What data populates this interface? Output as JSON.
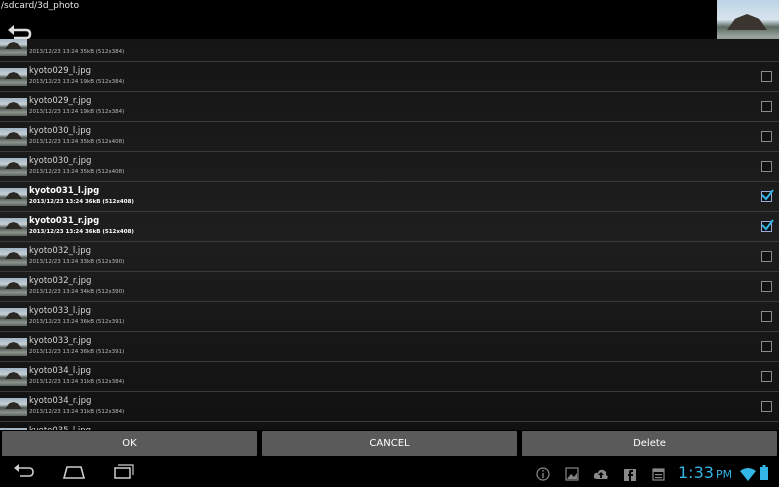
{
  "header": {
    "path": "/sdcard/3d_photo",
    "back_icon": "back-arrow-icon",
    "preview_icon": "photo-thumbnail"
  },
  "files": [
    {
      "name": "",
      "meta": "2013/12/23 13:24  35kB (512x384)",
      "checked": false,
      "partial": true
    },
    {
      "name": "kyoto029_l.jpg",
      "meta": "2013/12/23 13:24  19kB (512x384)",
      "checked": false
    },
    {
      "name": "kyoto029_r.jpg",
      "meta": "2013/12/23 13:24  19kB (512x384)",
      "checked": false
    },
    {
      "name": "kyoto030_l.jpg",
      "meta": "2013/12/23 13:24  35kB (512x408)",
      "checked": false
    },
    {
      "name": "kyoto030_r.jpg",
      "meta": "2013/12/23 13:24  35kB (512x408)",
      "checked": false
    },
    {
      "name": "kyoto031_l.jpg",
      "meta": "2013/12/23 13:24  36kB (512x408)",
      "checked": true
    },
    {
      "name": "kyoto031_r.jpg",
      "meta": "2013/12/23 13:24  36kB (512x408)",
      "checked": true
    },
    {
      "name": "kyoto032_l.jpg",
      "meta": "2013/12/23 13:24  33kB (512x390)",
      "checked": false
    },
    {
      "name": "kyoto032_r.jpg",
      "meta": "2013/12/23 13:24  34kB (512x390)",
      "checked": false
    },
    {
      "name": "kyoto033_l.jpg",
      "meta": "2013/12/23 13:24  36kB (512x391)",
      "checked": false
    },
    {
      "name": "kyoto033_r.jpg",
      "meta": "2013/12/23 13:24  36kB (512x391)",
      "checked": false
    },
    {
      "name": "kyoto034_l.jpg",
      "meta": "2013/12/23 13:24  31kB (512x384)",
      "checked": false
    },
    {
      "name": "kyoto034_r.jpg",
      "meta": "2013/12/23 13:24  31kB (512x384)",
      "checked": false
    },
    {
      "name": "kyoto035_l.jpg",
      "meta": "",
      "checked": false,
      "partial": true
    }
  ],
  "buttons": {
    "ok": "OK",
    "cancel": "CANCEL",
    "delete": "Delete"
  },
  "navbar": {
    "back_icon": "nav-back-icon",
    "home_icon": "nav-home-icon",
    "recents_icon": "nav-recents-icon"
  },
  "status": {
    "time": "1:33",
    "meridiem": "PM",
    "icons": [
      "info-icon",
      "gallery-icon",
      "cloud-upload-icon",
      "facebook-icon",
      "calendar-icon",
      "wifi-icon",
      "battery-icon"
    ]
  },
  "colors": {
    "accent": "#33b5e5",
    "button": "#5a5a5a",
    "check": "#33b5e5"
  }
}
